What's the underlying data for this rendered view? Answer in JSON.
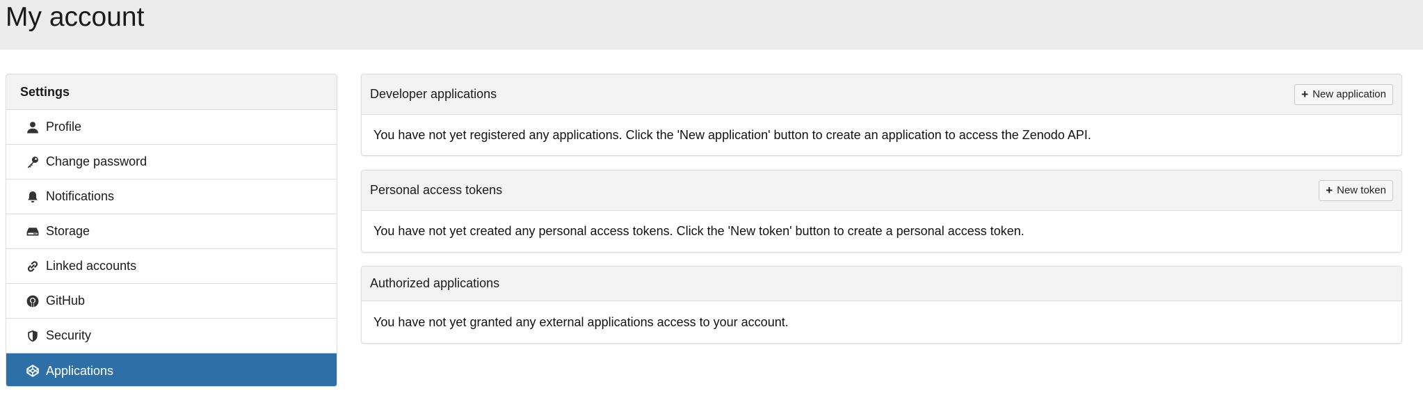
{
  "header": {
    "title": "My account"
  },
  "sidebar": {
    "heading": "Settings",
    "items": [
      {
        "label": "Profile",
        "icon": "user-icon",
        "active": false
      },
      {
        "label": "Change password",
        "icon": "key-icon",
        "active": false
      },
      {
        "label": "Notifications",
        "icon": "bell-icon",
        "active": false
      },
      {
        "label": "Storage",
        "icon": "hard-drive-icon",
        "active": false
      },
      {
        "label": "Linked accounts",
        "icon": "link-icon",
        "active": false
      },
      {
        "label": "GitHub",
        "icon": "github-icon",
        "active": false
      },
      {
        "label": "Security",
        "icon": "shield-icon",
        "active": false
      },
      {
        "label": "Applications",
        "icon": "codepen-icon",
        "active": true
      }
    ],
    "active_color": "#2f6fa8"
  },
  "panels": {
    "developer": {
      "title": "Developer applications",
      "button_label": "New application",
      "button_icon": "plus-icon",
      "body": "You have not yet registered any applications. Click the 'New application' button to create an application to access the Zenodo API."
    },
    "tokens": {
      "title": "Personal access tokens",
      "button_label": "New token",
      "button_icon": "plus-icon",
      "body": "You have not yet created any personal access tokens. Click the 'New token' button to create a personal access token."
    },
    "authorized": {
      "title": "Authorized applications",
      "body": "You have not yet granted any external applications access to your account."
    }
  }
}
